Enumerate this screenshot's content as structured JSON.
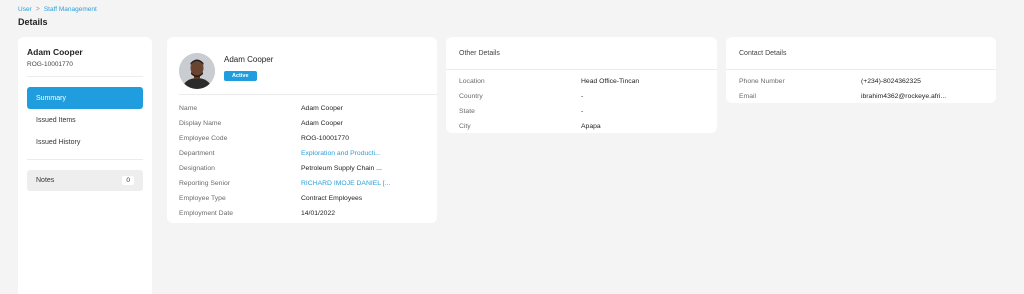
{
  "breadcrumb": {
    "items": [
      "User",
      "Staff Management"
    ],
    "separator": ">"
  },
  "page_title": "Details",
  "sidebar": {
    "name": "Adam Cooper",
    "code": "ROG-10001770",
    "menu": [
      {
        "label": "Summary",
        "active": true
      },
      {
        "label": "Issued Items",
        "active": false
      },
      {
        "label": "Issued History",
        "active": false
      }
    ],
    "notes": {
      "label": "Notes",
      "count": "0"
    }
  },
  "profile": {
    "name": "Adam Cooper",
    "status": "Active",
    "fields": [
      {
        "label": "Name",
        "value": "Adam Cooper",
        "link": false
      },
      {
        "label": "Display Name",
        "value": "Adam Cooper",
        "link": false
      },
      {
        "label": "Employee Code",
        "value": "ROG-10001770",
        "link": false
      },
      {
        "label": "Department",
        "value": "Exploration and Producti...",
        "link": true
      },
      {
        "label": "Designation",
        "value": "Petroleum Supply Chain ...",
        "link": false
      },
      {
        "label": "Reporting Senior",
        "value": "RICHARD IMOJE DANIEL [...",
        "link": true
      },
      {
        "label": "Employee Type",
        "value": "Contract Employees",
        "link": false
      },
      {
        "label": "Employment Date",
        "value": "14/01/2022",
        "link": false
      }
    ]
  },
  "other_details": {
    "heading": "Other Details",
    "fields": [
      {
        "label": "Location",
        "value": "Head Office-Tincan"
      },
      {
        "label": "Country",
        "value": "-"
      },
      {
        "label": "State",
        "value": "-"
      },
      {
        "label": "City",
        "value": "Apapa"
      }
    ]
  },
  "contact_details": {
    "heading": "Contact Details",
    "fields": [
      {
        "label": "Phone Number",
        "value": "(+234)-8024362325"
      },
      {
        "label": "Email",
        "value": "ibrahim4362@rockeye.afri..."
      }
    ]
  },
  "colors": {
    "accent": "#1f9ddf",
    "link": "#2a9fd8",
    "background": "#f4f4f5"
  }
}
